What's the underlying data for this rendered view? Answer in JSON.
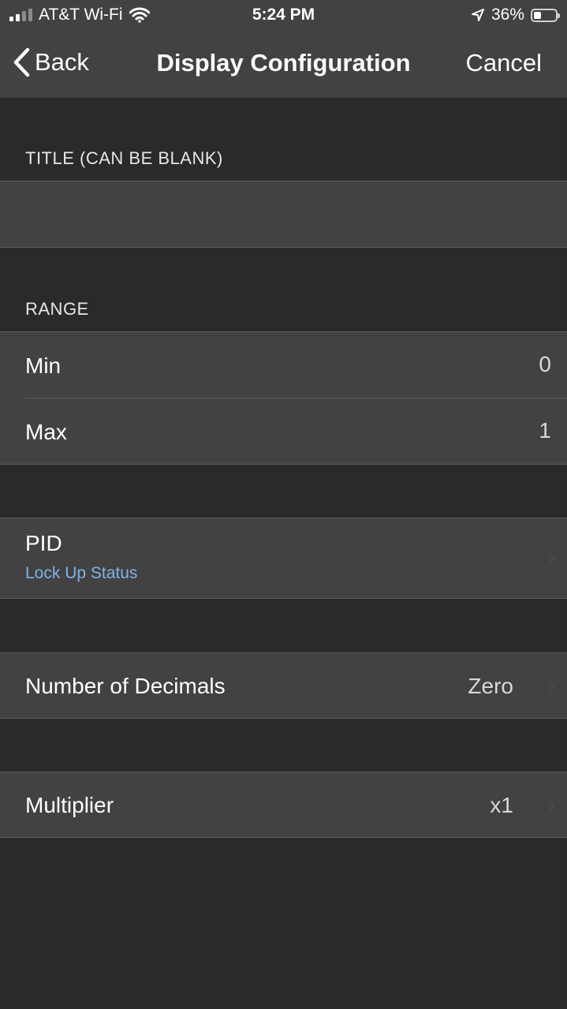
{
  "status_bar": {
    "carrier": "AT&T Wi-Fi",
    "time": "5:24 PM",
    "battery_percent": "36%",
    "battery_level": 0.36
  },
  "nav": {
    "back_label": "Back",
    "title": "Display Configuration",
    "cancel_label": "Cancel"
  },
  "sections": {
    "title_header": "TITLE (CAN BE BLANK)",
    "title_value": "",
    "range_header": "RANGE",
    "min_label": "Min",
    "min_value": "0",
    "max_label": "Max",
    "max_value": "1",
    "pid_label": "PID",
    "pid_value": "Lock Up Status",
    "decimals_label": "Number of Decimals",
    "decimals_value": "Zero",
    "multiplier_label": "Multiplier",
    "multiplier_value": "x1"
  },
  "colors": {
    "background": "#2a2a2a",
    "cell": "#424242",
    "accent": "#7fb2ea"
  }
}
